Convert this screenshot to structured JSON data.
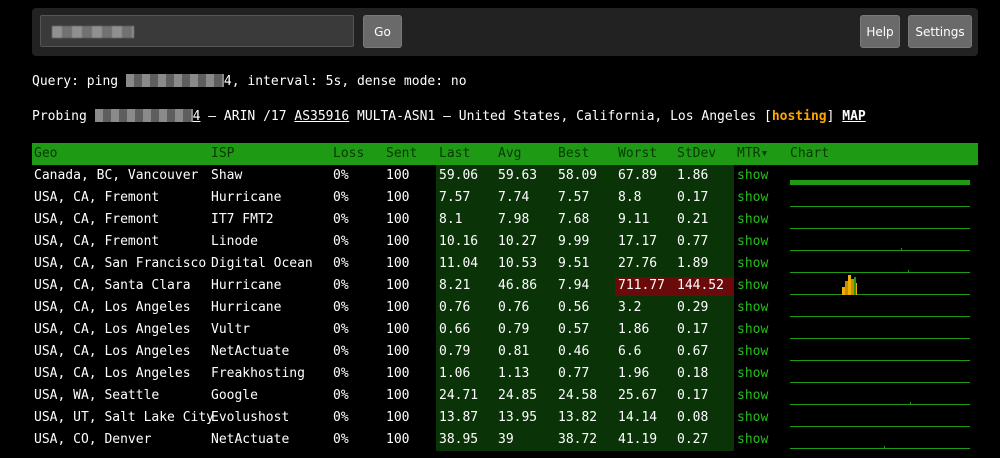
{
  "toolbar": {
    "go_label": "Go",
    "help_label": "Help",
    "settings_label": "Settings"
  },
  "query_line": {
    "prefix": "Query: ping ",
    "suffix": "4, interval: 5s, dense mode: no"
  },
  "probe_line": {
    "prefix": "Probing ",
    "ip_tail": "4",
    "registry": " — ARIN /17 ",
    "asn": "AS35916",
    "org_location": " MULTA-ASN1 — United States, California, Los Angeles [",
    "hosting": "hosting",
    "close_bracket": "] ",
    "map": "MAP"
  },
  "table": {
    "headers": {
      "geo": "Geo",
      "isp": "ISP",
      "loss": "Loss",
      "sent": "Sent",
      "last": "Last",
      "avg": "Avg",
      "best": "Best",
      "worst": "Worst",
      "stdev": "StDev",
      "mtr": "MTR▾",
      "chart": "Chart"
    },
    "rows": [
      {
        "geo": "Canada, BC, Vancouver",
        "isp": "Shaw",
        "loss": "0%",
        "sent": "100",
        "last": "59.06",
        "avg": "59.63",
        "best": "58.09",
        "worst": "67.89",
        "stdev": "1.86",
        "mtr": "show"
      },
      {
        "geo": "USA, CA, Fremont",
        "isp": "Hurricane",
        "loss": "0%",
        "sent": "100",
        "last": "7.57",
        "avg": "7.74",
        "best": "7.57",
        "worst": "8.8",
        "stdev": "0.17",
        "mtr": "show"
      },
      {
        "geo": "USA, CA, Fremont",
        "isp": "IT7 FMT2",
        "loss": "0%",
        "sent": "100",
        "last": "8.1",
        "avg": "7.98",
        "best": "7.68",
        "worst": "9.11",
        "stdev": "0.21",
        "mtr": "show"
      },
      {
        "geo": "USA, CA, Fremont",
        "isp": "Linode",
        "loss": "0%",
        "sent": "100",
        "last": "10.16",
        "avg": "10.27",
        "best": "9.99",
        "worst": "17.17",
        "stdev": "0.77",
        "mtr": "show"
      },
      {
        "geo": "USA, CA, San Francisco",
        "isp": "Digital Ocean",
        "loss": "0%",
        "sent": "100",
        "last": "11.04",
        "avg": "10.53",
        "best": "9.51",
        "worst": "27.76",
        "stdev": "1.89",
        "mtr": "show"
      },
      {
        "geo": "USA, CA, Santa Clara",
        "isp": "Hurricane",
        "loss": "0%",
        "sent": "100",
        "last": "8.21",
        "avg": "46.86",
        "best": "7.94",
        "worst": "711.77",
        "stdev": "144.52",
        "mtr": "show"
      },
      {
        "geo": "USA, CA, Los Angeles",
        "isp": "Hurricane",
        "loss": "0%",
        "sent": "100",
        "last": "0.76",
        "avg": "0.76",
        "best": "0.56",
        "worst": "3.2",
        "stdev": "0.29",
        "mtr": "show"
      },
      {
        "geo": "USA, CA, Los Angeles",
        "isp": "Vultr",
        "loss": "0%",
        "sent": "100",
        "last": "0.66",
        "avg": "0.79",
        "best": "0.57",
        "worst": "1.86",
        "stdev": "0.17",
        "mtr": "show"
      },
      {
        "geo": "USA, CA, Los Angeles",
        "isp": "NetActuate",
        "loss": "0%",
        "sent": "100",
        "last": "0.79",
        "avg": "0.81",
        "best": "0.46",
        "worst": "6.6",
        "stdev": "0.67",
        "mtr": "show"
      },
      {
        "geo": "USA, CA, Los Angeles",
        "isp": "Freakhosting",
        "loss": "0%",
        "sent": "100",
        "last": "1.06",
        "avg": "1.13",
        "best": "0.77",
        "worst": "1.96",
        "stdev": "0.18",
        "mtr": "show"
      },
      {
        "geo": "USA, WA, Seattle",
        "isp": "Google",
        "loss": "0%",
        "sent": "100",
        "last": "24.71",
        "avg": "24.85",
        "best": "24.58",
        "worst": "25.67",
        "stdev": "0.17",
        "mtr": "show"
      },
      {
        "geo": "USA, UT, Salt Lake City",
        "isp": "Evolushost",
        "loss": "0%",
        "sent": "100",
        "last": "13.87",
        "avg": "13.95",
        "best": "13.82",
        "worst": "14.14",
        "stdev": "0.08",
        "mtr": "show"
      },
      {
        "geo": "USA, CO, Denver",
        "isp": "NetActuate",
        "loss": "0%",
        "sent": "100",
        "last": "38.95",
        "avg": "39",
        "best": "38.72",
        "worst": "41.19",
        "stdev": "0.27",
        "mtr": "show"
      }
    ]
  },
  "colors": {
    "header_green": "#1f9a15",
    "metric_bg": "#0a3308",
    "alert_bg": "#6b0a0a",
    "link_green": "#22c01a",
    "hosting_orange": "#ffa500"
  }
}
